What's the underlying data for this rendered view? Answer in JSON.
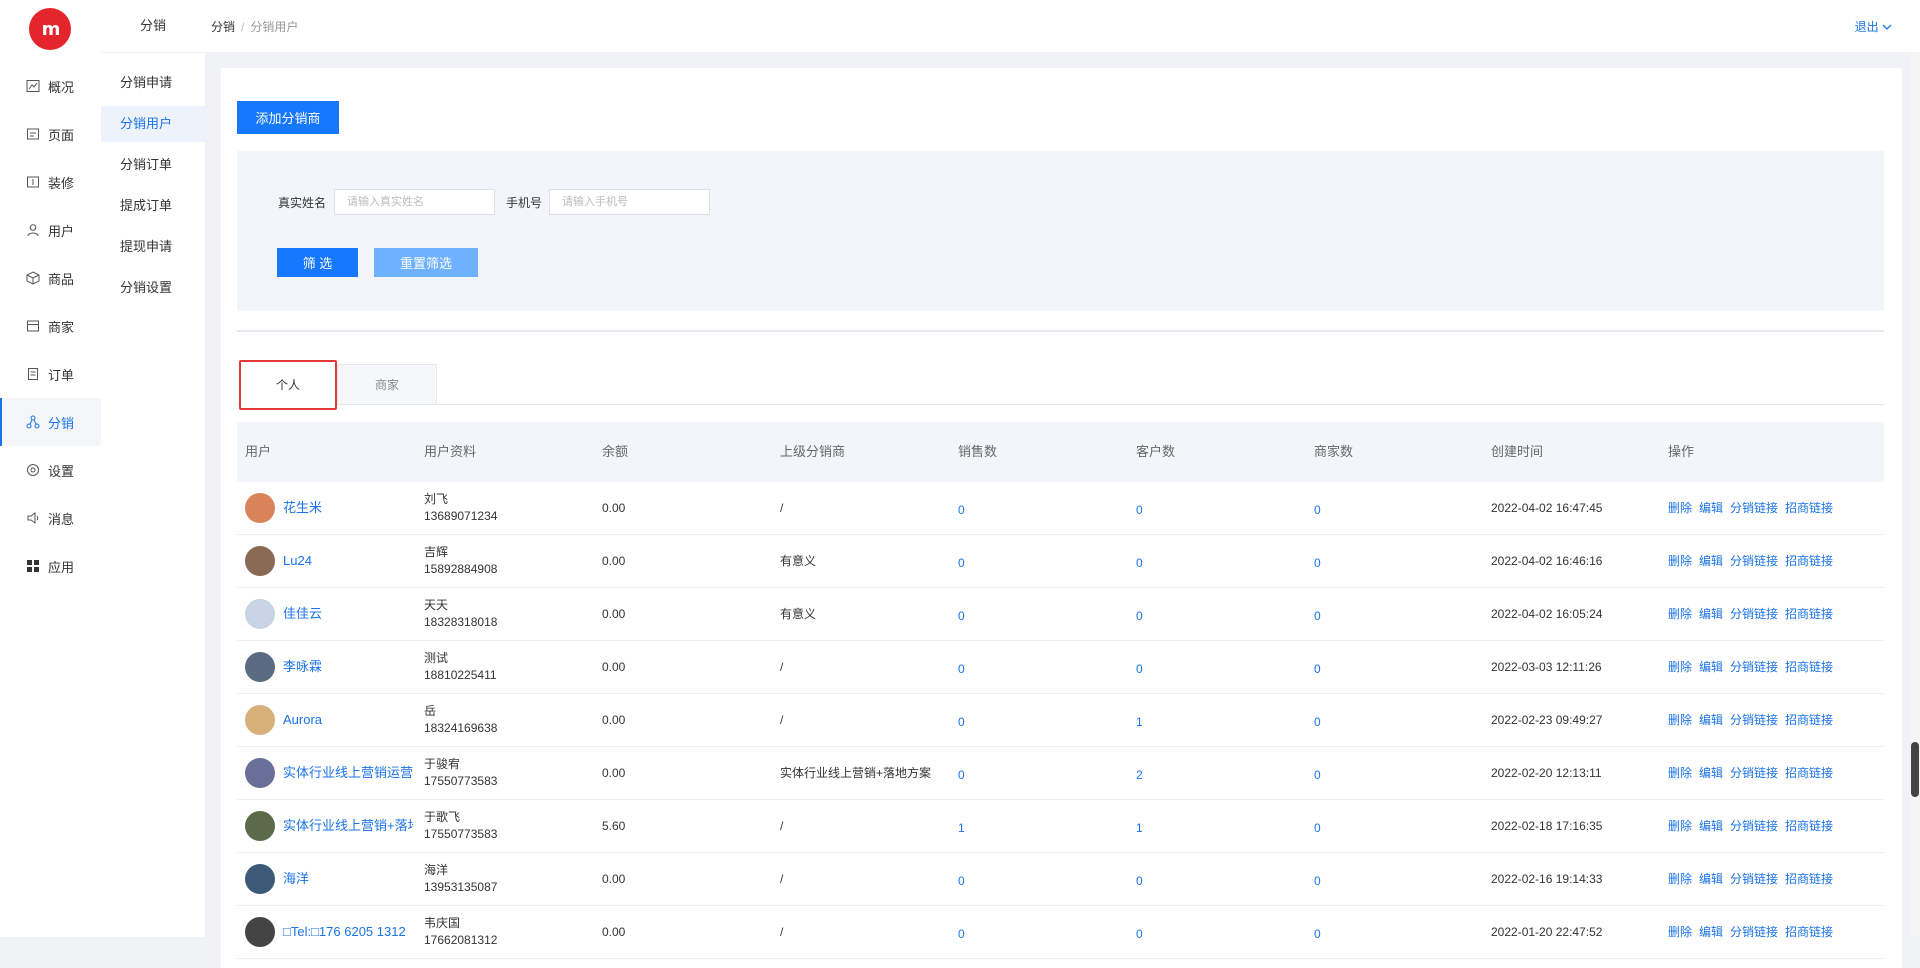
{
  "app": {
    "logo_text": "m",
    "brand_color": "#e4252b",
    "accent_color": "#1677ff"
  },
  "nav": {
    "items": [
      {
        "label": "概况",
        "icon": "chart-icon"
      },
      {
        "label": "页面",
        "icon": "page-icon"
      },
      {
        "label": "装修",
        "icon": "decorate-icon"
      },
      {
        "label": "用户",
        "icon": "user-icon"
      },
      {
        "label": "商品",
        "icon": "box-icon"
      },
      {
        "label": "商家",
        "icon": "store-icon"
      },
      {
        "label": "订单",
        "icon": "order-icon"
      },
      {
        "label": "分销",
        "icon": "distribution-icon",
        "active": true
      },
      {
        "label": "设置",
        "icon": "settings-icon"
      },
      {
        "label": "消息",
        "icon": "speaker-icon"
      },
      {
        "label": "应用",
        "icon": "apps-icon"
      }
    ]
  },
  "subnav": {
    "title": "分销",
    "items": [
      {
        "label": "分销申请"
      },
      {
        "label": "分销用户",
        "active": true
      },
      {
        "label": "分销订单"
      },
      {
        "label": "提成订单"
      },
      {
        "label": "提现申请"
      },
      {
        "label": "分销设置"
      }
    ]
  },
  "header": {
    "breadcrumb": [
      "分销",
      "分销用户"
    ],
    "logout": "退出"
  },
  "toolbar": {
    "add_label": "添加分销商"
  },
  "filter": {
    "name_label": "真实姓名",
    "name_placeholder": "请输入真实姓名",
    "phone_label": "手机号",
    "phone_placeholder": "请输入手机号",
    "filter_button": "筛 选",
    "reset_button": "重置筛选"
  },
  "tabs": [
    {
      "label": "个人",
      "active": true
    },
    {
      "label": "商家"
    }
  ],
  "table": {
    "columns": [
      "用户",
      "用户资料",
      "余额",
      "上级分销商",
      "销售数",
      "客户数",
      "商家数",
      "创建时间",
      "操作"
    ],
    "actions": [
      "删除",
      "编辑",
      "分销链接",
      "招商链接"
    ],
    "rows": [
      {
        "user": "花生米",
        "name": "刘飞",
        "phone": "13689071234",
        "balance": "0.00",
        "parent": "/",
        "sales": "0",
        "customers": "0",
        "merchants": "0",
        "created": "2022-04-02 16:47:45",
        "avatar_color": "#d9835a"
      },
      {
        "user": "Lu24",
        "name": "吉辉",
        "phone": "15892884908",
        "balance": "0.00",
        "parent": "有意义",
        "sales": "0",
        "customers": "0",
        "merchants": "0",
        "created": "2022-04-02 16:46:16",
        "avatar_color": "#8a6a55"
      },
      {
        "user": "佳佳云",
        "name": "天天",
        "phone": "18328318018",
        "balance": "0.00",
        "parent": "有意义",
        "sales": "0",
        "customers": "0",
        "merchants": "0",
        "created": "2022-04-02 16:05:24",
        "avatar_color": "#c8d4e3"
      },
      {
        "user": "李咏霖",
        "name": "测试",
        "phone": "18810225411",
        "balance": "0.00",
        "parent": "/",
        "sales": "0",
        "customers": "0",
        "merchants": "0",
        "created": "2022-03-03 12:11:26",
        "avatar_color": "#5a6a80"
      },
      {
        "user": "Aurora",
        "name": "岳",
        "phone": "18324169638",
        "balance": "0.00",
        "parent": "/",
        "sales": "0",
        "customers": "1",
        "merchants": "0",
        "created": "2022-02-23 09:49:27",
        "avatar_color": "#d7b07a"
      },
      {
        "user": "实体行业线上营销运营中",
        "name": "于骏宥",
        "phone": "17550773583",
        "balance": "0.00",
        "parent": "实体行业线上营销+落地方案",
        "sales": "0",
        "customers": "2",
        "merchants": "0",
        "created": "2022-02-20 12:13:11",
        "avatar_color": "#6a6f9a"
      },
      {
        "user": "实体行业线上营销+落地",
        "name": "于歌飞",
        "phone": "17550773583",
        "balance": "5.60",
        "parent": "/",
        "sales": "1",
        "customers": "1",
        "merchants": "0",
        "created": "2022-02-18 17:16:35",
        "avatar_color": "#5b6b4a"
      },
      {
        "user": "海洋",
        "name": "海洋",
        "phone": "13953135087",
        "balance": "0.00",
        "parent": "/",
        "sales": "0",
        "customers": "0",
        "merchants": "0",
        "created": "2022-02-16 19:14:33",
        "avatar_color": "#3c5a78"
      },
      {
        "user": "□Tel:□176 6205 1312",
        "name": "韦庆国",
        "phone": "17662081312",
        "balance": "0.00",
        "parent": "/",
        "sales": "0",
        "customers": "0",
        "merchants": "0",
        "created": "2022-01-20 22:47:52",
        "avatar_color": "#444444"
      }
    ]
  }
}
